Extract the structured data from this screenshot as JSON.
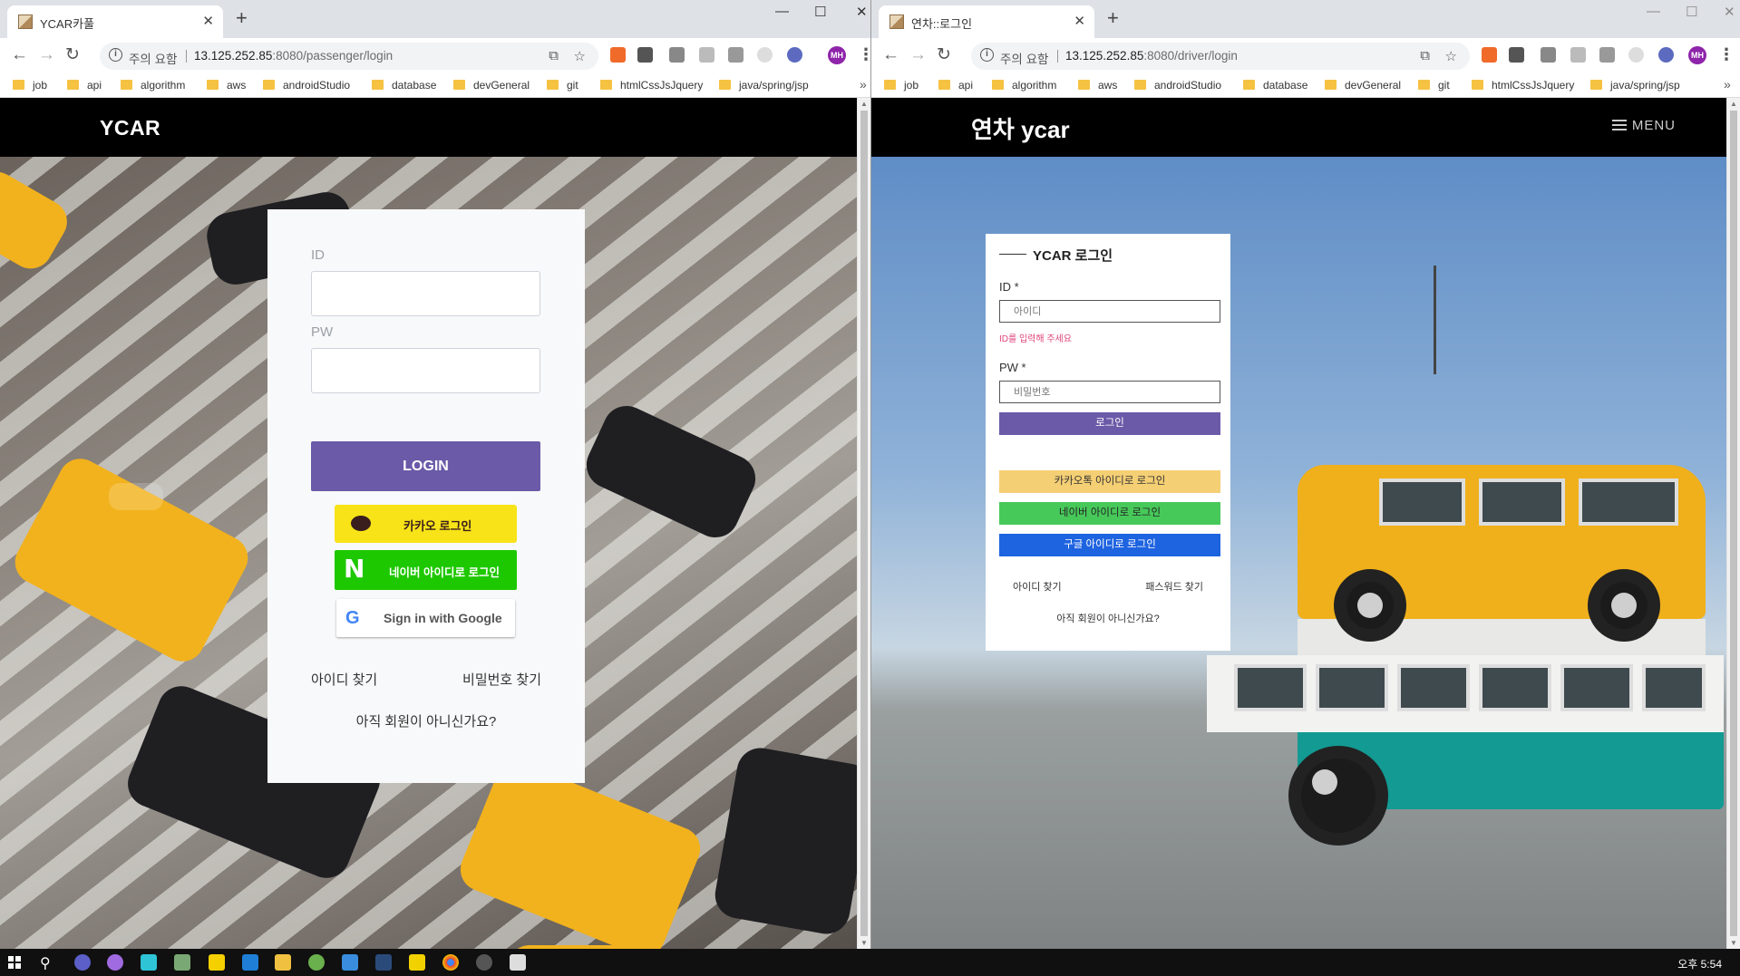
{
  "left": {
    "tab_title": "YCAR카풀",
    "omnibox": {
      "warning": "주의 요함",
      "host": "13.125.252.85",
      "path": ":8080/passenger/login"
    },
    "page": {
      "brand": "YCAR",
      "id_label": "ID",
      "pw_label": "PW",
      "login_label": "LOGIN",
      "kakao_label": "카카오 로그인",
      "naver_label": "네이버 아이디로 로그인",
      "naver_logo": "N",
      "google_label": "Sign in with Google",
      "google_logo": "G",
      "find_id": "아이디 찾기",
      "find_pw": "비밀번호 찾기",
      "signup": "아직 회원이 아니신가요?"
    }
  },
  "right": {
    "tab_title": "연차::로그인",
    "omnibox": {
      "warning": "주의 요함",
      "host": "13.125.252.85",
      "path": ":8080/driver/login"
    },
    "page": {
      "brand": "연차 ycar",
      "menu_label": "MENU",
      "card_title": "YCAR 로그인",
      "id_label": "ID *",
      "id_placeholder": "아이디",
      "id_error": "ID를 입력해 주세요",
      "pw_label": "PW *",
      "pw_placeholder": "비밀번호",
      "login_label": "로그인",
      "kakao_label": "카카오톡 아이디로 로그인",
      "naver_label": "네이버 아이디로 로그인",
      "google_label": "구글 아이디로 로그인",
      "find_id": "아이디 찾기",
      "find_pw": "패스워드 찾기",
      "signup": "아직 회원이 아니신가요?"
    }
  },
  "bookmarks": [
    "job",
    "api",
    "algorithm",
    "aws",
    "androidStudio",
    "database",
    "devGeneral",
    "git",
    "htmlCssJsJquery",
    "java/spring/jsp"
  ],
  "bookmarks_overflow": "»",
  "profile_initials": "MH",
  "taskbar": {
    "clock": "오후 5:54"
  },
  "colors": {
    "login_purple": "#6a5aa8",
    "kakao_yellow": "#f7e317",
    "naver_green": "#1ec800",
    "r_kakao": "#f5cf74",
    "r_naver": "#47c95a",
    "r_google": "#1e63e0",
    "error_pink": "#e0457b"
  }
}
